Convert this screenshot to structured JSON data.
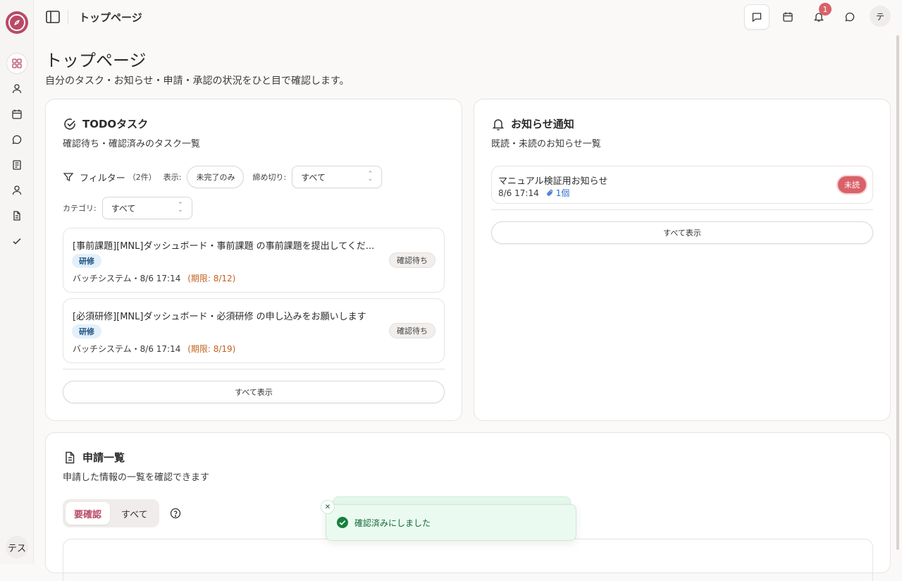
{
  "topbar": {
    "title": "トップページ",
    "notification_count": "1",
    "avatar_initial": "テ"
  },
  "sidebar": {
    "items": [
      {
        "icon": "dashboard-icon"
      },
      {
        "icon": "user-icon"
      },
      {
        "icon": "calendar-icon"
      },
      {
        "icon": "chat-icon"
      },
      {
        "icon": "book-icon"
      },
      {
        "icon": "person-icon"
      },
      {
        "icon": "document-icon"
      },
      {
        "icon": "check-icon"
      }
    ],
    "user_label": "テス"
  },
  "page": {
    "title": "トップページ",
    "subtitle": "自分のタスク・お知らせ・申請・承認の状況をひと目で確認します。"
  },
  "todo": {
    "title": "TODOタスク",
    "subtitle": "確認待ち・確認済みのタスク一覧",
    "filter_label": "フィルター",
    "filter_count": "（2件）",
    "display_label": "表示:",
    "display_value": "未完了のみ",
    "deadline_label": "締め切り:",
    "deadline_value": "すべて",
    "category_label": "カテゴリ:",
    "category_value": "すべて",
    "tasks": [
      {
        "title": "[事前課題][MNL]ダッシュボード・事前課題 の事前課題を提出してくだ...",
        "tag": "研修",
        "status": "確認待ち",
        "meta": "バッチシステム・8/6 17:14",
        "due": "(期限: 8/12)"
      },
      {
        "title": "[必須研修][MNL]ダッシュボード・必須研修 の申し込みをお願いします",
        "tag": "研修",
        "status": "確認待ち",
        "meta": "バッチシステム・8/6 17:14",
        "due": "(期限: 8/19)"
      }
    ],
    "show_all": "すべて表示"
  },
  "notices": {
    "title": "お知らせ通知",
    "subtitle": "既読・未読のお知らせ一覧",
    "items": [
      {
        "title": "マニュアル検証用お知らせ",
        "date": "8/6 17:14",
        "attachments": "1個",
        "status": "未読"
      }
    ],
    "show_all": "すべて表示"
  },
  "applications": {
    "title": "申請一覧",
    "subtitle": "申請した情報の一覧を確認できます",
    "tabs": [
      {
        "label": "要確認",
        "active": true
      },
      {
        "label": "すべて",
        "active": false
      }
    ]
  },
  "toast": {
    "message": "確認済みにしました"
  },
  "colors": {
    "accent": "#b94a66",
    "badge": "#d9616a",
    "due": "#c2621f",
    "toast_bg": "#ebfaf0",
    "tag_bg": "#e3f0fb"
  }
}
